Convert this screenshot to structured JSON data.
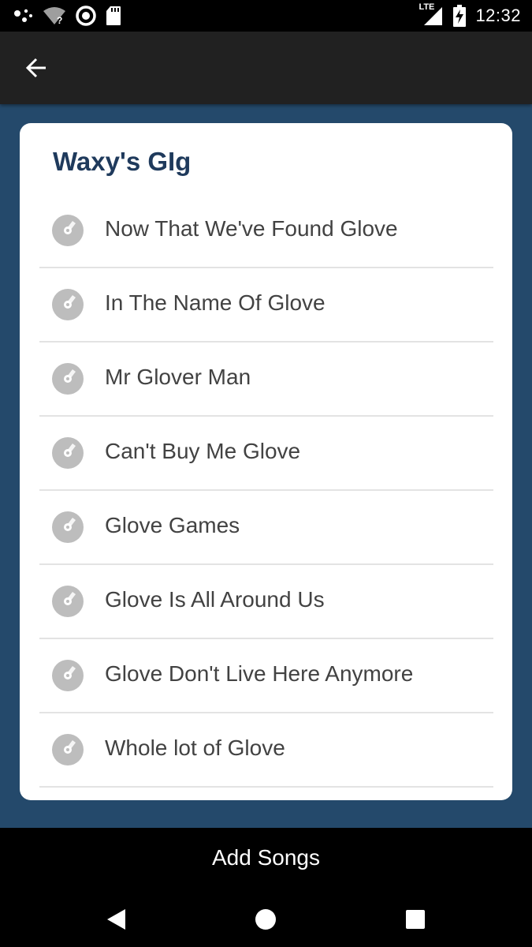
{
  "status_bar": {
    "time": "12:32",
    "network_label": "LTE",
    "icons": [
      "assistant-icon",
      "wifi-unknown-icon",
      "sync-icon",
      "sd-card-icon",
      "signal-icon",
      "battery-charging-icon"
    ]
  },
  "app_bar": {
    "back_icon": "arrow-back-icon"
  },
  "gig": {
    "title": "Waxy's GIg",
    "songs": [
      {
        "title": "Now That We've Found Glove"
      },
      {
        "title": "In The Name Of Glove"
      },
      {
        "title": "Mr Glover Man"
      },
      {
        "title": "Can't Buy Me Glove"
      },
      {
        "title": "Glove Games"
      },
      {
        "title": "Glove Is All Around Us"
      },
      {
        "title": "Glove Don't Live Here Anymore"
      },
      {
        "title": "Whole lot of Glove"
      }
    ],
    "song_icon": "disc-icon"
  },
  "bottom": {
    "add_songs_label": "Add Songs"
  },
  "nav": {
    "buttons": [
      "back-triangle-icon",
      "home-circle-icon",
      "recents-square-icon"
    ]
  },
  "colors": {
    "background": "#24496b",
    "app_bar": "#212121",
    "title": "#1f3a5c",
    "icon_gray": "#bdbdbd"
  }
}
